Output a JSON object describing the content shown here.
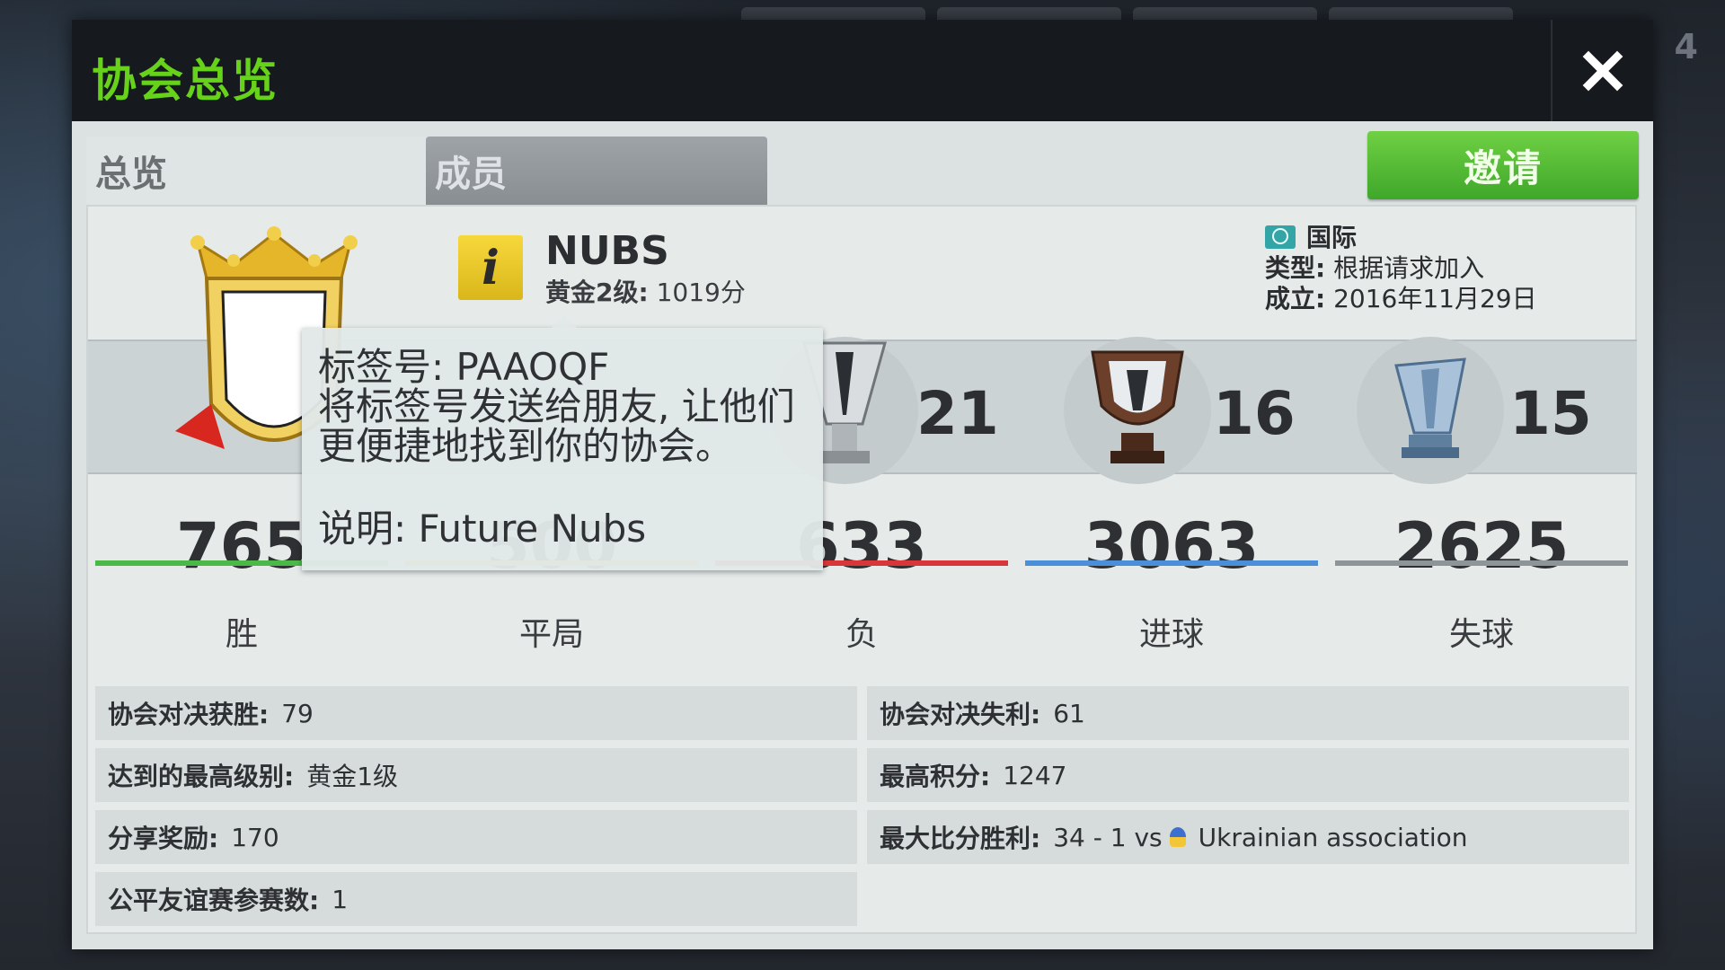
{
  "dialog": {
    "title": "协会总览",
    "close_icon": "close-icon"
  },
  "tabs": {
    "overview": "总览",
    "members": "成员"
  },
  "invite_label": "邀请",
  "club": {
    "name": "NUBS",
    "league_label": "黄金2级:",
    "league_points": "1019分"
  },
  "meta": {
    "region": "国际",
    "type_label": "类型:",
    "type_value": "根据请求加入",
    "founded_label": "成立:",
    "founded_value": "2016年11月29日"
  },
  "trophies": [
    {
      "icon": "silver-trophy-icon",
      "count": "21"
    },
    {
      "icon": "bronze-trophy-icon",
      "count": "16"
    },
    {
      "icon": "blue-trophy-icon",
      "count": "15"
    }
  ],
  "stats": [
    {
      "value": "765",
      "label": "胜",
      "color": "#4cb848"
    },
    {
      "value": "500",
      "label": "平局",
      "color": "#e2c43a"
    },
    {
      "value": "633",
      "label": "负",
      "color": "#d9363a"
    },
    {
      "value": "3063",
      "label": "进球",
      "color": "#4a8fd8"
    },
    {
      "value": "2625",
      "label": "失球",
      "color": "#8e9598"
    }
  ],
  "details": {
    "h2h_wins_label": "协会对决获胜:",
    "h2h_wins": "79",
    "h2h_losses_label": "协会对决失利:",
    "h2h_losses": "61",
    "top_level_label": "达到的最高级别:",
    "top_level": "黄金1级",
    "top_points_label": "最高积分:",
    "top_points": "1247",
    "share_reward_label": "分享奖励:",
    "share_reward": "170",
    "biggest_win_label": "最大比分胜利:",
    "biggest_win_score": "34 - 1 vs",
    "biggest_win_opponent": "Ukrainian association",
    "fair_friendly_label": "公平友谊赛参赛数:",
    "fair_friendly": "1"
  },
  "tooltip": {
    "tag": "标签号: PAAOQF",
    "tip": "将标签号发送给朋友, 让他们更便捷地找到你的协会。",
    "desc": "说明: Future Nubs"
  },
  "background": {
    "corner_number": "4"
  }
}
